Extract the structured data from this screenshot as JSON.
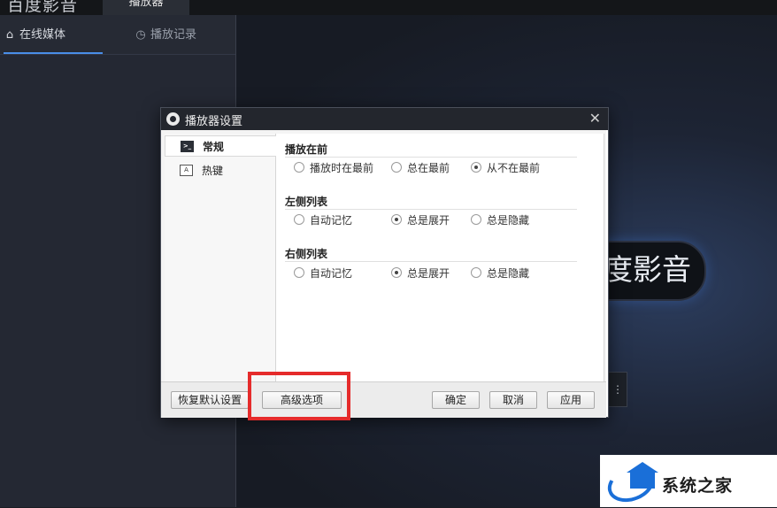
{
  "app": {
    "title": "百度影音",
    "player_tab": "播放器"
  },
  "left_panel": {
    "tabs": [
      {
        "label": "在线媒体",
        "icon": "home-icon"
      },
      {
        "label": "播放记录",
        "icon": "clock-icon"
      }
    ]
  },
  "stage": {
    "logo_text": "度影音",
    "open_button_text": "⋮",
    "watermark_partial": "    "
  },
  "dialog": {
    "title": "播放器设置",
    "nav": [
      {
        "label": "常规",
        "icon": ">_",
        "active": true
      },
      {
        "label": "热键",
        "icon": "A",
        "active": false
      }
    ],
    "sections": [
      {
        "title": "播放在前",
        "options": [
          {
            "label": "播放时在最前",
            "checked": false
          },
          {
            "label": "总在最前",
            "checked": false
          },
          {
            "label": "从不在最前",
            "checked": true
          }
        ]
      },
      {
        "title": "左侧列表",
        "options": [
          {
            "label": "自动记忆",
            "checked": false
          },
          {
            "label": "总是展开",
            "checked": true
          },
          {
            "label": "总是隐藏",
            "checked": false
          }
        ]
      },
      {
        "title": "右侧列表",
        "options": [
          {
            "label": "自动记忆",
            "checked": false
          },
          {
            "label": "总是展开",
            "checked": true
          },
          {
            "label": "总是隐藏",
            "checked": false
          }
        ]
      }
    ],
    "buttons": {
      "restore_defaults": "恢复默认设置",
      "advanced": "高级选项",
      "ok": "确定",
      "cancel": "取消",
      "apply": "应用"
    },
    "highlight_color": "#e52b2b"
  },
  "watermark": {
    "text": "系统之家",
    "brand_color": "#1a6fd8"
  }
}
